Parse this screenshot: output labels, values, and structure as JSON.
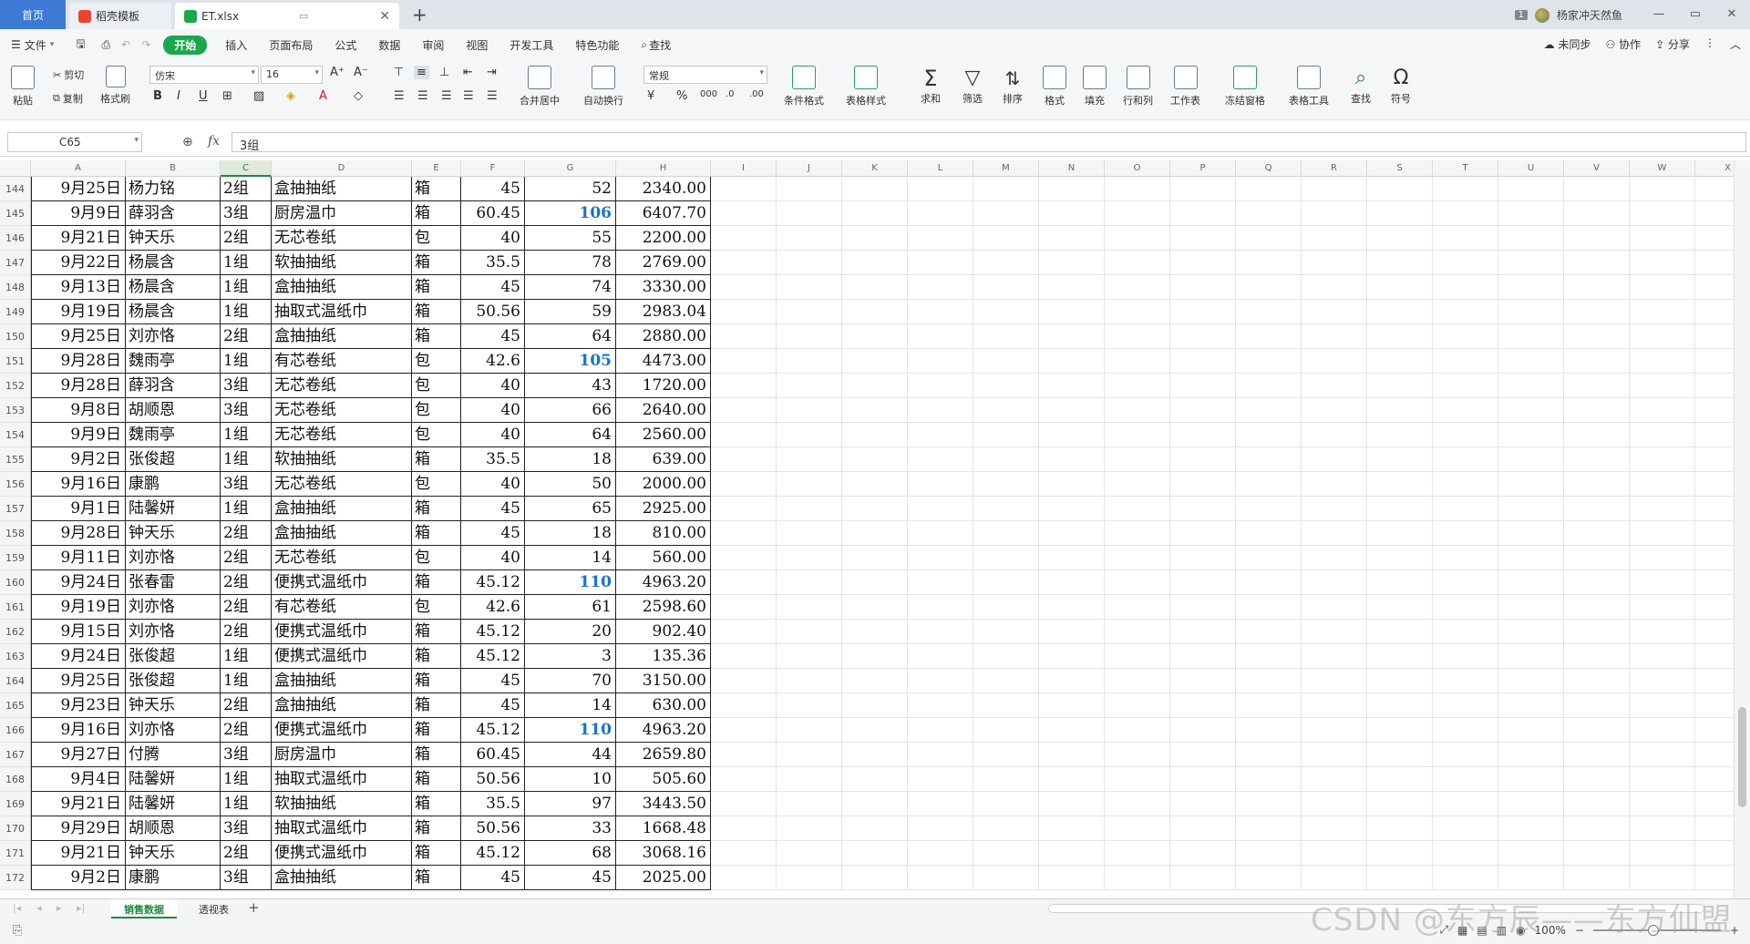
{
  "titlebar": {
    "tabs": [
      "首页",
      "稻壳模板",
      "ET.xlsx"
    ],
    "new_tab": "+",
    "window_count": "1",
    "user_name": "杨家冲天然鱼",
    "window_controls": [
      "—",
      "▭",
      "✕"
    ]
  },
  "menu": {
    "file": "文件",
    "items": [
      "开始",
      "插入",
      "页面布局",
      "公式",
      "数据",
      "审阅",
      "视图",
      "开发工具",
      "特色功能"
    ],
    "search": "查找",
    "right": [
      "未同步",
      "协作",
      "分享"
    ]
  },
  "ribbon": {
    "paste": "粘贴",
    "cut": "剪切",
    "copy": "复制",
    "format_painter": "格式刷",
    "font_name": "仿宋",
    "font_size": "16",
    "merge_center": "合并居中",
    "wrap_text": "自动换行",
    "number_format": "常规",
    "buttons": [
      "条件格式",
      "表格样式",
      "求和",
      "筛选",
      "排序",
      "格式",
      "填充",
      "行和列",
      "工作表",
      "冻结窗格",
      "表格工具",
      "查找",
      "符号"
    ]
  },
  "formula_bar": {
    "name_box": "C65",
    "fx": "fx",
    "value": "3组"
  },
  "columns": [
    "A",
    "B",
    "C",
    "D",
    "E",
    "F",
    "G",
    "H",
    "I",
    "J",
    "K",
    "L",
    "M",
    "N",
    "O",
    "P",
    "Q",
    "R",
    "S",
    "T",
    "U",
    "V",
    "W",
    "X"
  ],
  "selected_column": "C",
  "rows": [
    {
      "n": "144",
      "a": "9月25日",
      "b": "杨力铭",
      "c": "2组",
      "d": "盒抽抽纸",
      "e": "箱",
      "f": "45",
      "g": "52",
      "h": "2340.00",
      "hi": false
    },
    {
      "n": "145",
      "a": "9月9日",
      "b": "薛羽含",
      "c": "3组",
      "d": "厨房温巾",
      "e": "箱",
      "f": "60.45",
      "g": "106",
      "h": "6407.70",
      "hi": true
    },
    {
      "n": "146",
      "a": "9月21日",
      "b": "钟天乐",
      "c": "2组",
      "d": "无芯卷纸",
      "e": "包",
      "f": "40",
      "g": "55",
      "h": "2200.00",
      "hi": false
    },
    {
      "n": "147",
      "a": "9月22日",
      "b": "杨晨含",
      "c": "1组",
      "d": "软抽抽纸",
      "e": "箱",
      "f": "35.5",
      "g": "78",
      "h": "2769.00",
      "hi": false
    },
    {
      "n": "148",
      "a": "9月13日",
      "b": "杨晨含",
      "c": "1组",
      "d": "盒抽抽纸",
      "e": "箱",
      "f": "45",
      "g": "74",
      "h": "3330.00",
      "hi": false
    },
    {
      "n": "149",
      "a": "9月19日",
      "b": "杨晨含",
      "c": "1组",
      "d": "抽取式温纸巾",
      "e": "箱",
      "f": "50.56",
      "g": "59",
      "h": "2983.04",
      "hi": false
    },
    {
      "n": "150",
      "a": "9月25日",
      "b": "刘亦恪",
      "c": "2组",
      "d": "盒抽抽纸",
      "e": "箱",
      "f": "45",
      "g": "64",
      "h": "2880.00",
      "hi": false
    },
    {
      "n": "151",
      "a": "9月28日",
      "b": "魏雨亭",
      "c": "1组",
      "d": "有芯卷纸",
      "e": "包",
      "f": "42.6",
      "g": "105",
      "h": "4473.00",
      "hi": true
    },
    {
      "n": "152",
      "a": "9月28日",
      "b": "薛羽含",
      "c": "3组",
      "d": "无芯卷纸",
      "e": "包",
      "f": "40",
      "g": "43",
      "h": "1720.00",
      "hi": false
    },
    {
      "n": "153",
      "a": "9月8日",
      "b": "胡顺恩",
      "c": "3组",
      "d": "无芯卷纸",
      "e": "包",
      "f": "40",
      "g": "66",
      "h": "2640.00",
      "hi": false
    },
    {
      "n": "154",
      "a": "9月9日",
      "b": "魏雨亭",
      "c": "1组",
      "d": "无芯卷纸",
      "e": "包",
      "f": "40",
      "g": "64",
      "h": "2560.00",
      "hi": false
    },
    {
      "n": "155",
      "a": "9月2日",
      "b": "张俊超",
      "c": "1组",
      "d": "软抽抽纸",
      "e": "箱",
      "f": "35.5",
      "g": "18",
      "h": "639.00",
      "hi": false
    },
    {
      "n": "156",
      "a": "9月16日",
      "b": "康鹏",
      "c": "3组",
      "d": "无芯卷纸",
      "e": "包",
      "f": "40",
      "g": "50",
      "h": "2000.00",
      "hi": false
    },
    {
      "n": "157",
      "a": "9月1日",
      "b": "陆馨妍",
      "c": "1组",
      "d": "盒抽抽纸",
      "e": "箱",
      "f": "45",
      "g": "65",
      "h": "2925.00",
      "hi": false
    },
    {
      "n": "158",
      "a": "9月28日",
      "b": "钟天乐",
      "c": "2组",
      "d": "盒抽抽纸",
      "e": "箱",
      "f": "45",
      "g": "18",
      "h": "810.00",
      "hi": false
    },
    {
      "n": "159",
      "a": "9月11日",
      "b": "刘亦恪",
      "c": "2组",
      "d": "无芯卷纸",
      "e": "包",
      "f": "40",
      "g": "14",
      "h": "560.00",
      "hi": false
    },
    {
      "n": "160",
      "a": "9月24日",
      "b": "张春雷",
      "c": "2组",
      "d": "便携式温纸巾",
      "e": "箱",
      "f": "45.12",
      "g": "110",
      "h": "4963.20",
      "hi": true
    },
    {
      "n": "161",
      "a": "9月19日",
      "b": "刘亦恪",
      "c": "2组",
      "d": "有芯卷纸",
      "e": "包",
      "f": "42.6",
      "g": "61",
      "h": "2598.60",
      "hi": false
    },
    {
      "n": "162",
      "a": "9月15日",
      "b": "刘亦恪",
      "c": "2组",
      "d": "便携式温纸巾",
      "e": "箱",
      "f": "45.12",
      "g": "20",
      "h": "902.40",
      "hi": false
    },
    {
      "n": "163",
      "a": "9月24日",
      "b": "张俊超",
      "c": "1组",
      "d": "便携式温纸巾",
      "e": "箱",
      "f": "45.12",
      "g": "3",
      "h": "135.36",
      "hi": false
    },
    {
      "n": "164",
      "a": "9月25日",
      "b": "张俊超",
      "c": "1组",
      "d": "盒抽抽纸",
      "e": "箱",
      "f": "45",
      "g": "70",
      "h": "3150.00",
      "hi": false
    },
    {
      "n": "165",
      "a": "9月23日",
      "b": "钟天乐",
      "c": "2组",
      "d": "盒抽抽纸",
      "e": "箱",
      "f": "45",
      "g": "14",
      "h": "630.00",
      "hi": false
    },
    {
      "n": "166",
      "a": "9月16日",
      "b": "刘亦恪",
      "c": "2组",
      "d": "便携式温纸巾",
      "e": "箱",
      "f": "45.12",
      "g": "110",
      "h": "4963.20",
      "hi": true
    },
    {
      "n": "167",
      "a": "9月27日",
      "b": "付腾",
      "c": "3组",
      "d": "厨房温巾",
      "e": "箱",
      "f": "60.45",
      "g": "44",
      "h": "2659.80",
      "hi": false
    },
    {
      "n": "168",
      "a": "9月4日",
      "b": "陆馨妍",
      "c": "1组",
      "d": "抽取式温纸巾",
      "e": "箱",
      "f": "50.56",
      "g": "10",
      "h": "505.60",
      "hi": false
    },
    {
      "n": "169",
      "a": "9月21日",
      "b": "陆馨妍",
      "c": "1组",
      "d": "软抽抽纸",
      "e": "箱",
      "f": "35.5",
      "g": "97",
      "h": "3443.50",
      "hi": false
    },
    {
      "n": "170",
      "a": "9月29日",
      "b": "胡顺恩",
      "c": "3组",
      "d": "抽取式温纸巾",
      "e": "箱",
      "f": "50.56",
      "g": "33",
      "h": "1668.48",
      "hi": false
    },
    {
      "n": "171",
      "a": "9月21日",
      "b": "钟天乐",
      "c": "2组",
      "d": "便携式温纸巾",
      "e": "箱",
      "f": "45.12",
      "g": "68",
      "h": "3068.16",
      "hi": false
    },
    {
      "n": "172",
      "a": "9月2日",
      "b": "康鹏",
      "c": "3组",
      "d": "盒抽抽纸",
      "e": "箱",
      "f": "45",
      "g": "45",
      "h": "2025.00",
      "hi": false
    }
  ],
  "sheets": [
    "销售数据",
    "透视表"
  ],
  "add_sheet": "+",
  "status": {
    "zoom": "100%",
    "minus": "−",
    "plus": "+"
  },
  "watermark": "CSDN @东方辰——东方仙盟",
  "colors": {
    "accent_green": "#1ba74c",
    "highlight_blue": "#1a73c7",
    "home_tab": "#3d7ad6"
  }
}
